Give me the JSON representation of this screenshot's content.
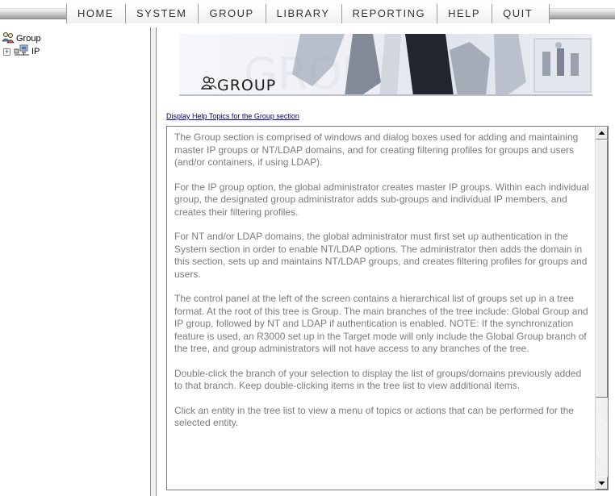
{
  "menu": {
    "items": [
      "HOME",
      "SYSTEM",
      "GROUP",
      "LIBRARY",
      "REPORTING",
      "HELP",
      "QUIT"
    ]
  },
  "tree": {
    "root_label": "Group",
    "root_icon": "group-users-icon",
    "children": [
      {
        "label": "IP",
        "icon": "network-computer-icon",
        "expander": "+"
      }
    ]
  },
  "banner": {
    "title": "GROUP",
    "title_icon": "group-users-icon"
  },
  "help_link": "Display Help Topics for the Group section",
  "help_text": {
    "paragraphs": [
      "The Group section is comprised of windows and dialog boxes used for adding and maintaining master IP groups or NT/LDAP domains, and for creating filtering profiles for groups and users (and/or containers, if using LDAP).",
      "For the IP group option, the global administrator creates master IP groups. Within each individual group, the designated group administrator adds sub-groups and individual IP members, and creates their filtering profiles.",
      "For NT and/or LDAP domains, the global administrator must first set up authentication in the System section in order to enable NT/LDAP options. The administrator then adds the domain in this section, sets up and maintains NT/LDAP groups, and creates filtering profiles for groups and users.",
      "The control panel at the left of the screen contains a hierarchical list of groups set up in a tree format. At the root of this tree is Group. The main branches of the tree include: Global Group and IP group, followed by NT and LDAP if authentication is enabled. NOTE: If the synchronization feature is used, an R3000 set up in the Target mode will only include the Global Group branch of the tree, and group administrators will not have access to any branches of the tree.",
      "Double-click the branch of your selection to display the list of groups/domains previously added to that branch. Keep double-clicking items in the tree list to view additional items.",
      "Click an entity in the tree list to view a menu of topics or actions that can be performed for the selected entity."
    ]
  },
  "colors": {
    "link": "#00008b",
    "body_text": "#7b7b7b",
    "menu_text": "#333333"
  }
}
